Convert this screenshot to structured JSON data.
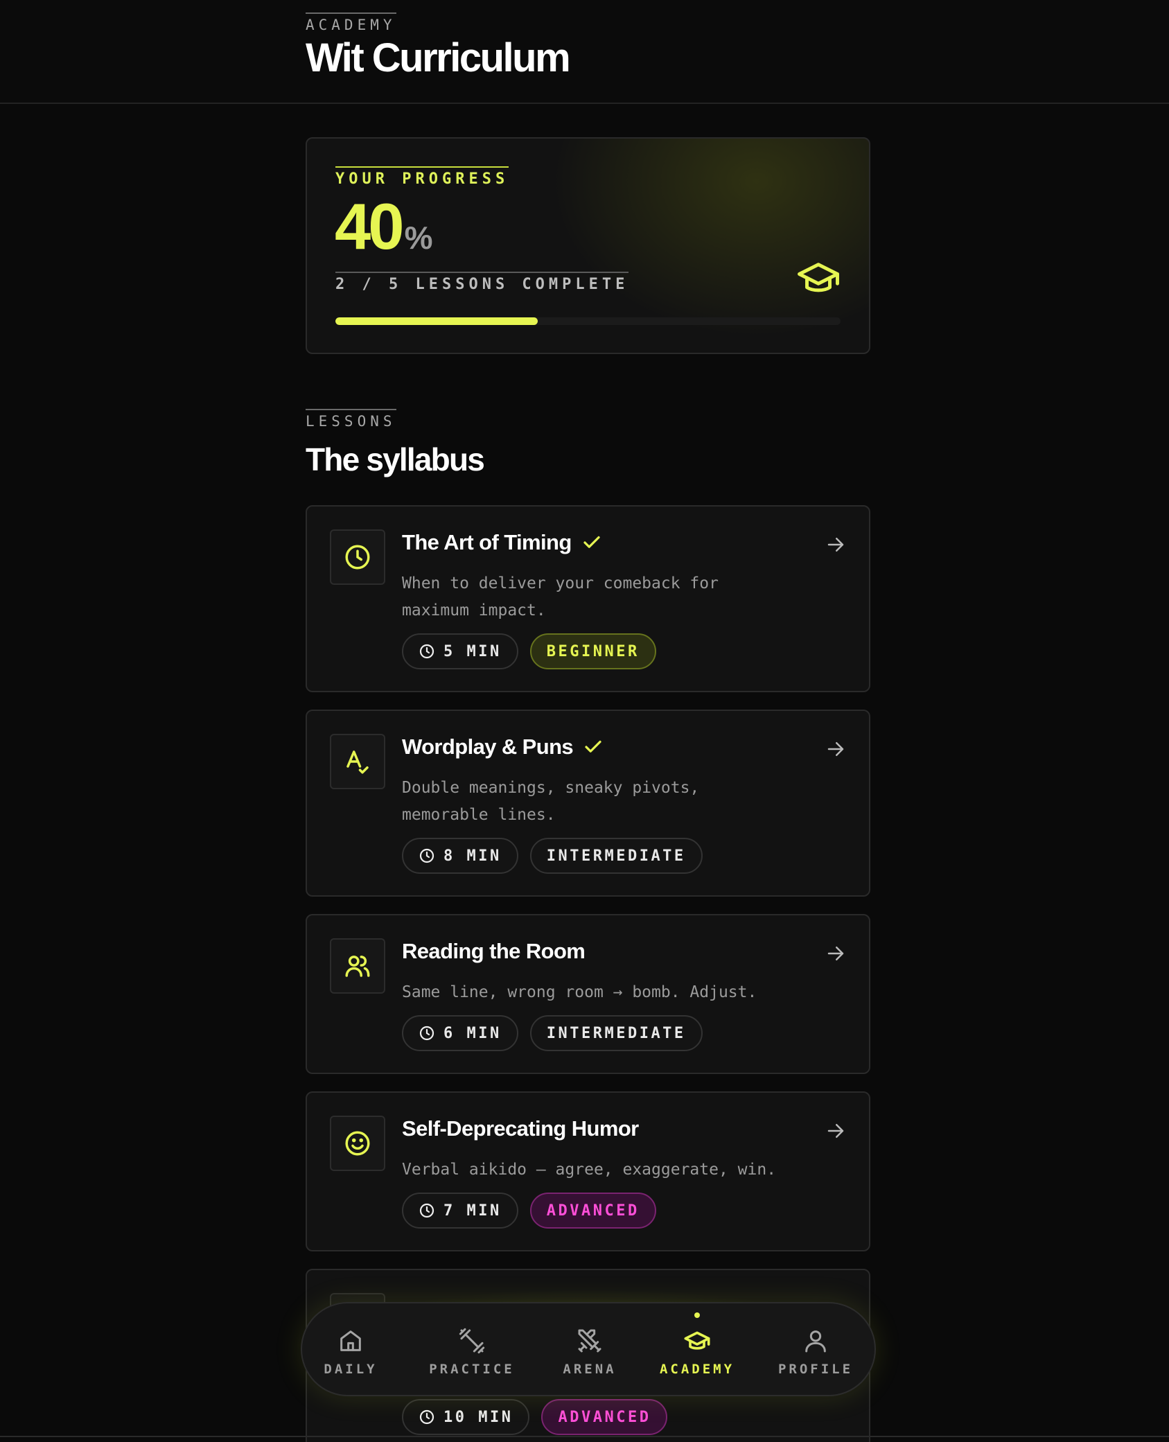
{
  "header": {
    "eyebrow": "ACADEMY",
    "title": "Wit Curriculum"
  },
  "progress": {
    "label": "YOUR PROGRESS",
    "percent": "40",
    "percent_symbol": "%",
    "fraction": 0.4,
    "lessons_complete": "2 / 5 LESSONS COMPLETE",
    "icon": "graduation-cap-icon"
  },
  "lessons": {
    "eyebrow": "LESSONS",
    "title": "The syllabus",
    "items": [
      {
        "title": "The Art of Timing",
        "completed": true,
        "icon": "clock-icon",
        "description": "When to deliver your comeback for maximum impact.",
        "duration": "5 MIN",
        "level": "BEGINNER"
      },
      {
        "title": "Wordplay & Puns",
        "completed": true,
        "icon": "spell-check-icon",
        "description": "Double meanings, sneaky pivots, memorable lines.",
        "duration": "8 MIN",
        "level": "INTERMEDIATE"
      },
      {
        "title": "Reading the Room",
        "completed": false,
        "icon": "users-icon",
        "description": "Same line, wrong room → bomb. Adjust.",
        "duration": "6 MIN",
        "level": "INTERMEDIATE"
      },
      {
        "title": "Self-Deprecating Humor",
        "completed": false,
        "icon": "smile-icon",
        "description": "Verbal aikido — agree, exaggerate, win.",
        "duration": "7 MIN",
        "level": "ADVANCED"
      },
      {
        "title": "",
        "completed": false,
        "icon": "",
        "description": "",
        "duration": "10 MIN",
        "level": "ADVANCED"
      }
    ]
  },
  "nav": {
    "items": [
      {
        "label": "DAILY",
        "icon": "home-icon",
        "active": false
      },
      {
        "label": "PRACTICE",
        "icon": "dumbbell-icon",
        "active": false
      },
      {
        "label": "ARENA",
        "icon": "crossed-swords-icon",
        "active": false
      },
      {
        "label": "ACADEMY",
        "icon": "graduation-cap-icon",
        "active": true
      },
      {
        "label": "PROFILE",
        "icon": "user-icon",
        "active": false
      }
    ]
  },
  "colors": {
    "accent": "#e6f552",
    "advanced": "#ff4fd8",
    "background": "#0a0a0a",
    "card": "#121212"
  }
}
